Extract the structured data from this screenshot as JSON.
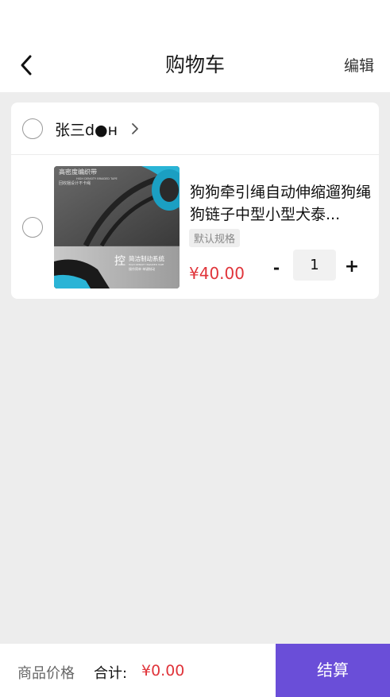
{
  "header": {
    "title": "购物车",
    "edit_label": "编辑",
    "back_icon": "back-arrow-icon"
  },
  "cart": {
    "shop": {
      "name": "张三d●н",
      "chevron_icon": "chevron-right-icon"
    },
    "items": [
      {
        "title": "狗狗牵引绳自动伸缩遛狗绳狗链子中型小型犬泰...",
        "spec": "默认规格",
        "price": "¥40.00",
        "quantity": "1",
        "minus_label": "-",
        "plus_label": "+",
        "thumbnail_texts": [
          "高密度编织带",
          "HIGH DENSITY BRAIDED TAPE",
          "回收捆设计不卡绳",
          "控",
          "简洁制动系统",
          "HIGH DENSITY BRAIDED TAPE",
          "操作简单 单键制动"
        ]
      }
    ]
  },
  "footer": {
    "price_label": "商品价格",
    "total_label": "合计:",
    "total_value": "¥0.00",
    "checkout_label": "结算"
  },
  "colors": {
    "accent": "#6a4ed8",
    "price": "#e0343a",
    "background": "#ededed"
  }
}
